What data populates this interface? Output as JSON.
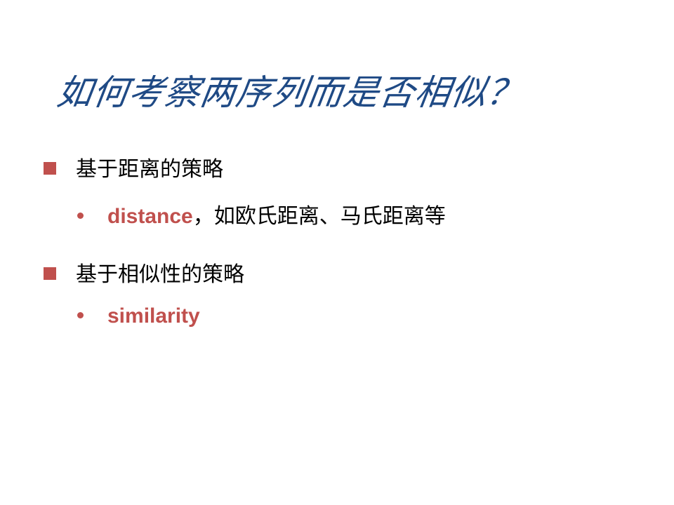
{
  "title": "如何考察两序列而是否相似？",
  "bullets": [
    {
      "text": "基于距离的策略",
      "sub": {
        "term": "distance",
        "rest": "，如欧氏距离、马氏距离等"
      }
    },
    {
      "text": "基于相似性的策略",
      "sub": {
        "term": "similarity",
        "rest": ""
      }
    }
  ],
  "colors": {
    "title": "#1f4a85",
    "accent": "#c0504d"
  }
}
